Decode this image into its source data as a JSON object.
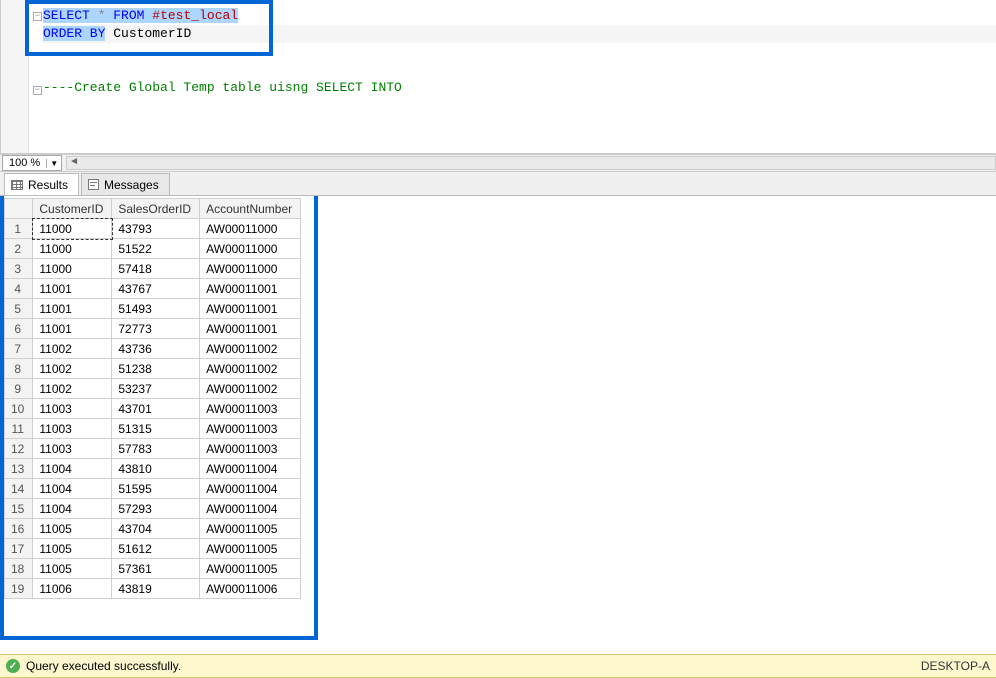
{
  "editor": {
    "line1_select": "SELECT",
    "line1_star": "*",
    "line1_from": "FROM",
    "line1_table": "#test_local",
    "line2_orderby": "ORDER BY",
    "line2_col": "CustomerID",
    "comment_line": "----Create Global Temp table uisng SELECT INTO"
  },
  "zoom": {
    "value": "100 %"
  },
  "tabs": {
    "results": "Results",
    "messages": "Messages"
  },
  "grid": {
    "columns": [
      "CustomerID",
      "SalesOrderID",
      "AccountNumber"
    ],
    "selected_cell": "11000",
    "rows": [
      {
        "n": "1",
        "c": "11000",
        "s": "43793",
        "a": "AW00011000"
      },
      {
        "n": "2",
        "c": "11000",
        "s": "51522",
        "a": "AW00011000"
      },
      {
        "n": "3",
        "c": "11000",
        "s": "57418",
        "a": "AW00011000"
      },
      {
        "n": "4",
        "c": "11001",
        "s": "43767",
        "a": "AW00011001"
      },
      {
        "n": "5",
        "c": "11001",
        "s": "51493",
        "a": "AW00011001"
      },
      {
        "n": "6",
        "c": "11001",
        "s": "72773",
        "a": "AW00011001"
      },
      {
        "n": "7",
        "c": "11002",
        "s": "43736",
        "a": "AW00011002"
      },
      {
        "n": "8",
        "c": "11002",
        "s": "51238",
        "a": "AW00011002"
      },
      {
        "n": "9",
        "c": "11002",
        "s": "53237",
        "a": "AW00011002"
      },
      {
        "n": "10",
        "c": "11003",
        "s": "43701",
        "a": "AW00011003"
      },
      {
        "n": "11",
        "c": "11003",
        "s": "51315",
        "a": "AW00011003"
      },
      {
        "n": "12",
        "c": "11003",
        "s": "57783",
        "a": "AW00011003"
      },
      {
        "n": "13",
        "c": "11004",
        "s": "43810",
        "a": "AW00011004"
      },
      {
        "n": "14",
        "c": "11004",
        "s": "51595",
        "a": "AW00011004"
      },
      {
        "n": "15",
        "c": "11004",
        "s": "57293",
        "a": "AW00011004"
      },
      {
        "n": "16",
        "c": "11005",
        "s": "43704",
        "a": "AW00011005"
      },
      {
        "n": "17",
        "c": "11005",
        "s": "51612",
        "a": "AW00011005"
      },
      {
        "n": "18",
        "c": "11005",
        "s": "57361",
        "a": "AW00011005"
      },
      {
        "n": "19",
        "c": "11006",
        "s": "43819",
        "a": "AW00011006"
      }
    ]
  },
  "status": {
    "message": "Query executed successfully.",
    "server": "DESKTOP-A"
  }
}
